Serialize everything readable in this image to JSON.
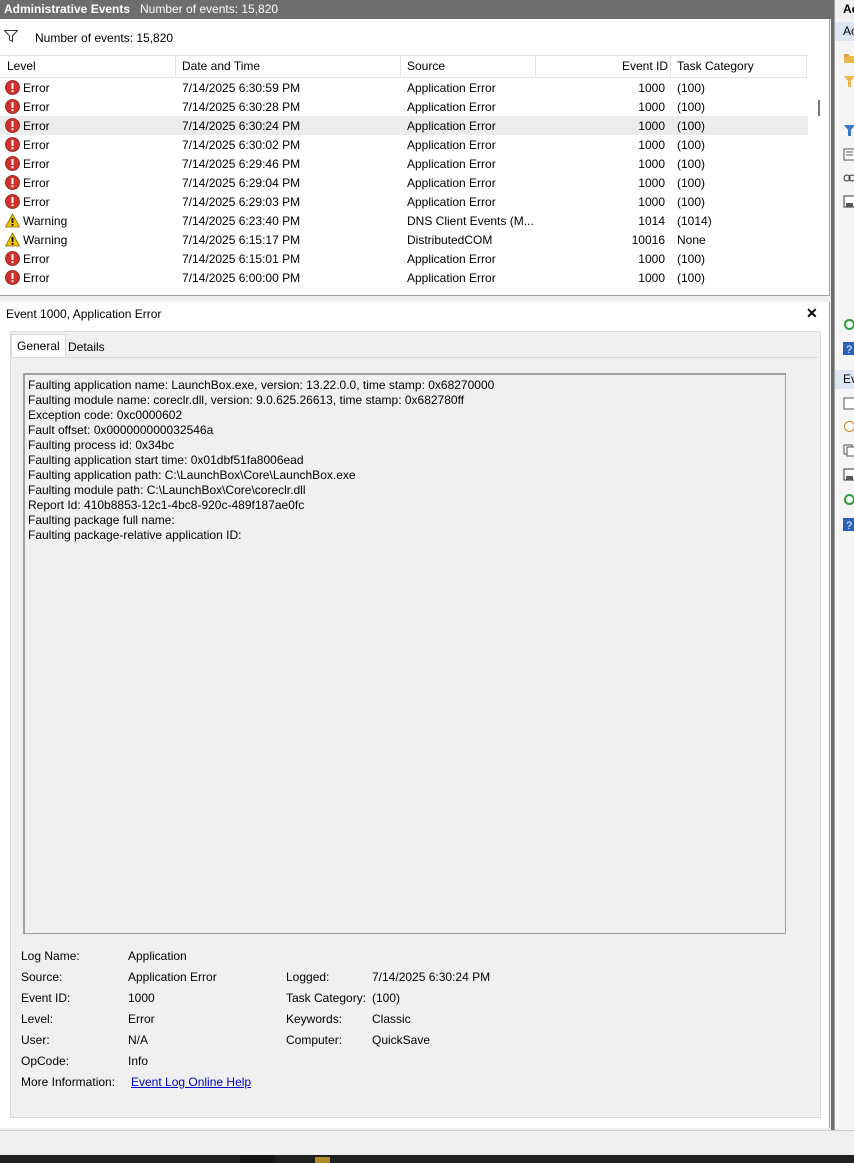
{
  "window": {
    "title": "Administrative Events",
    "count_label": "Number of events: 15,820"
  },
  "filter_bar": {
    "text": "Number of events: 15,820"
  },
  "columns": {
    "level": "Level",
    "datetime": "Date and Time",
    "source": "Source",
    "event_id": "Event ID",
    "task_category": "Task Category"
  },
  "events": [
    {
      "level": "Error",
      "icon": "error-icon",
      "datetime": "7/14/2025 6:30:59 PM",
      "source": "Application Error",
      "event_id": "1000",
      "task": "(100)"
    },
    {
      "level": "Error",
      "icon": "error-icon",
      "datetime": "7/14/2025 6:30:28 PM",
      "source": "Application Error",
      "event_id": "1000",
      "task": "(100)"
    },
    {
      "level": "Error",
      "icon": "error-icon",
      "datetime": "7/14/2025 6:30:24 PM",
      "source": "Application Error",
      "event_id": "1000",
      "task": "(100)",
      "selected": true
    },
    {
      "level": "Error",
      "icon": "error-icon",
      "datetime": "7/14/2025 6:30:02 PM",
      "source": "Application Error",
      "event_id": "1000",
      "task": "(100)"
    },
    {
      "level": "Error",
      "icon": "error-icon",
      "datetime": "7/14/2025 6:29:46 PM",
      "source": "Application Error",
      "event_id": "1000",
      "task": "(100)"
    },
    {
      "level": "Error",
      "icon": "error-icon",
      "datetime": "7/14/2025 6:29:04 PM",
      "source": "Application Error",
      "event_id": "1000",
      "task": "(100)"
    },
    {
      "level": "Error",
      "icon": "error-icon",
      "datetime": "7/14/2025 6:29:03 PM",
      "source": "Application Error",
      "event_id": "1000",
      "task": "(100)"
    },
    {
      "level": "Warning",
      "icon": "warning-icon",
      "datetime": "7/14/2025 6:23:40 PM",
      "source": "DNS Client Events (M...",
      "event_id": "1014",
      "task": "(1014)"
    },
    {
      "level": "Warning",
      "icon": "warning-icon",
      "datetime": "7/14/2025 6:15:17 PM",
      "source": "DistributedCOM",
      "event_id": "10016",
      "task": "None"
    },
    {
      "level": "Error",
      "icon": "error-icon",
      "datetime": "7/14/2025 6:15:01 PM",
      "source": "Application Error",
      "event_id": "1000",
      "task": "(100)"
    },
    {
      "level": "Error",
      "icon": "error-icon",
      "datetime": "7/14/2025 6:00:00 PM",
      "source": "Application Error",
      "event_id": "1000",
      "task": "(100)"
    }
  ],
  "detail": {
    "title": "Event 1000, Application Error",
    "close_glyph": "✕",
    "tabs": {
      "general": "General",
      "details": "Details"
    },
    "description": [
      "Faulting application name: LaunchBox.exe, version: 13.22.0.0, time stamp: 0x68270000",
      "Faulting module name: coreclr.dll, version: 9.0.625.26613, time stamp: 0x682780ff",
      "Exception code: 0xc0000602",
      "Fault offset: 0x000000000032546a",
      "Faulting process id: 0x34bc",
      "Faulting application start time: 0x01dbf51fa8006ead",
      "Faulting application path: C:\\LaunchBox\\Core\\LaunchBox.exe",
      "Faulting module path: C:\\LaunchBox\\Core\\coreclr.dll",
      "Report Id: 410b8853-12c1-4bc8-920c-489f187ae0fc",
      "Faulting package full name: ",
      "Faulting package-relative application ID: "
    ],
    "fields": {
      "log_name_label": "Log Name:",
      "log_name": "Application",
      "source_label": "Source:",
      "source": "Application Error",
      "logged_label": "Logged:",
      "logged": "7/14/2025 6:30:24 PM",
      "event_id_label": "Event ID:",
      "event_id": "1000",
      "task_category_label": "Task Category:",
      "task_category": "(100)",
      "level_label": "Level:",
      "level": "Error",
      "keywords_label": "Keywords:",
      "keywords": "Classic",
      "user_label": "User:",
      "user": "N/A",
      "computer_label": "Computer:",
      "computer": "QuickSave",
      "opcode_label": "OpCode:",
      "opcode": "Info",
      "more_info_label": "More Information:",
      "more_info_link": "Event Log Online Help"
    }
  },
  "actions_pane": {
    "header": "Ac",
    "sub1": "Ac",
    "sub2": "Ev"
  },
  "colors": {
    "error": "#d0312d",
    "warning": "#f2c200",
    "link": "#0000cc",
    "titlebar": "#6d6d6d"
  }
}
